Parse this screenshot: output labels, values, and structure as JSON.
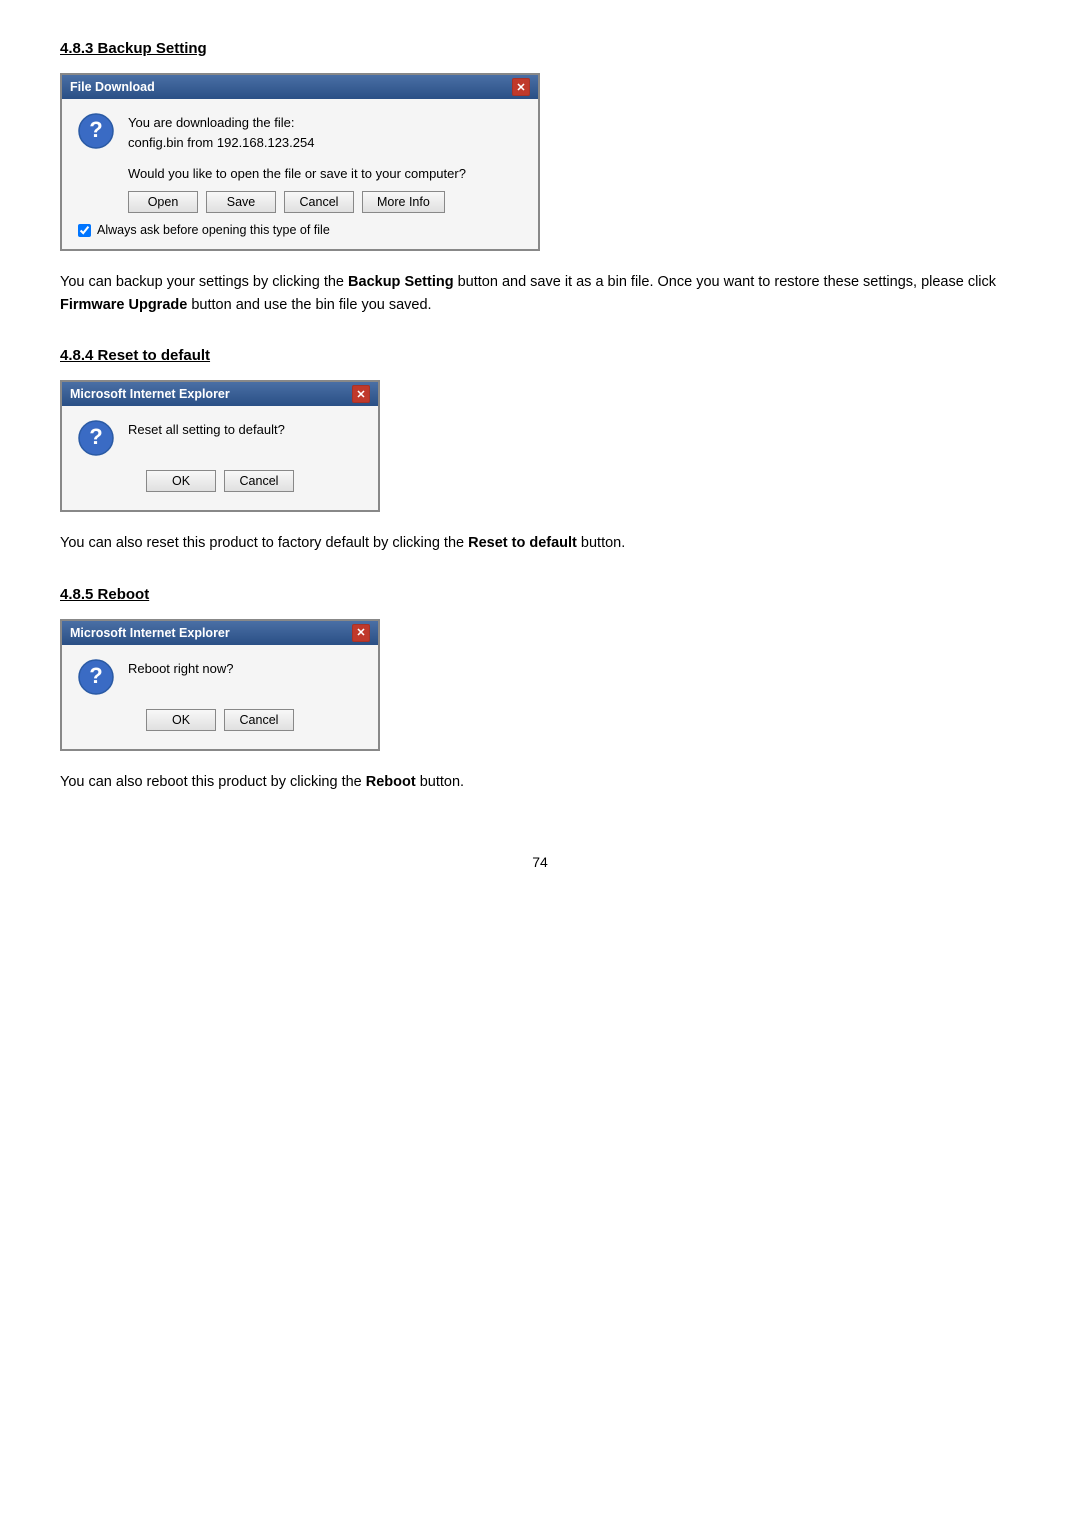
{
  "sections": [
    {
      "id": "backup-setting",
      "heading": "4.8.3 Backup Setting",
      "dialog": {
        "type": "file-download",
        "title": "File Download",
        "download_text_line1": "You are downloading the file:",
        "download_text_line2": "config.bin from 192.168.123.254",
        "question": "Would you like to open the file or save it to your computer?",
        "buttons": [
          "Open",
          "Save",
          "Cancel",
          "More Info"
        ],
        "open_label": "Open",
        "save_label": "Save",
        "cancel_label": "Cancel",
        "more_info_label": "More Info",
        "checkbox_label": "Always ask before opening this type of file",
        "checkbox_checked": true
      },
      "body_text": "You can backup your settings by clicking the Backup Setting button and save it as a bin file. Once you want to restore these settings, please click Firmware Upgrade button and use the bin file you saved.",
      "bold_words": [
        "Backup Setting",
        "Firmware Upgrade"
      ]
    },
    {
      "id": "reset-to-default",
      "heading": "4.8.4 Reset to default",
      "dialog": {
        "type": "ie",
        "title": "Microsoft Internet Explorer",
        "message": "Reset all setting to default?",
        "buttons": [
          "OK",
          "Cancel"
        ],
        "ok_label": "OK",
        "cancel_label": "Cancel"
      },
      "body_text": "You can also reset this product to factory default by clicking the Reset to default button.",
      "bold_words": [
        "Reset to default"
      ]
    },
    {
      "id": "reboot",
      "heading": "4.8.5 Reboot",
      "dialog": {
        "type": "ie",
        "title": "Microsoft Internet Explorer",
        "message": "Reboot right now?",
        "buttons": [
          "OK",
          "Cancel"
        ],
        "ok_label": "OK",
        "cancel_label": "Cancel"
      },
      "body_text": "You can also reboot this product by clicking the Reboot button.",
      "bold_words": [
        "Reboot"
      ]
    }
  ],
  "page_number": "74",
  "icons": {
    "question_mark": "❓",
    "close_x": "✕"
  },
  "colors": {
    "titlebar_start": "#4a6fa5",
    "titlebar_end": "#2a4f85"
  }
}
